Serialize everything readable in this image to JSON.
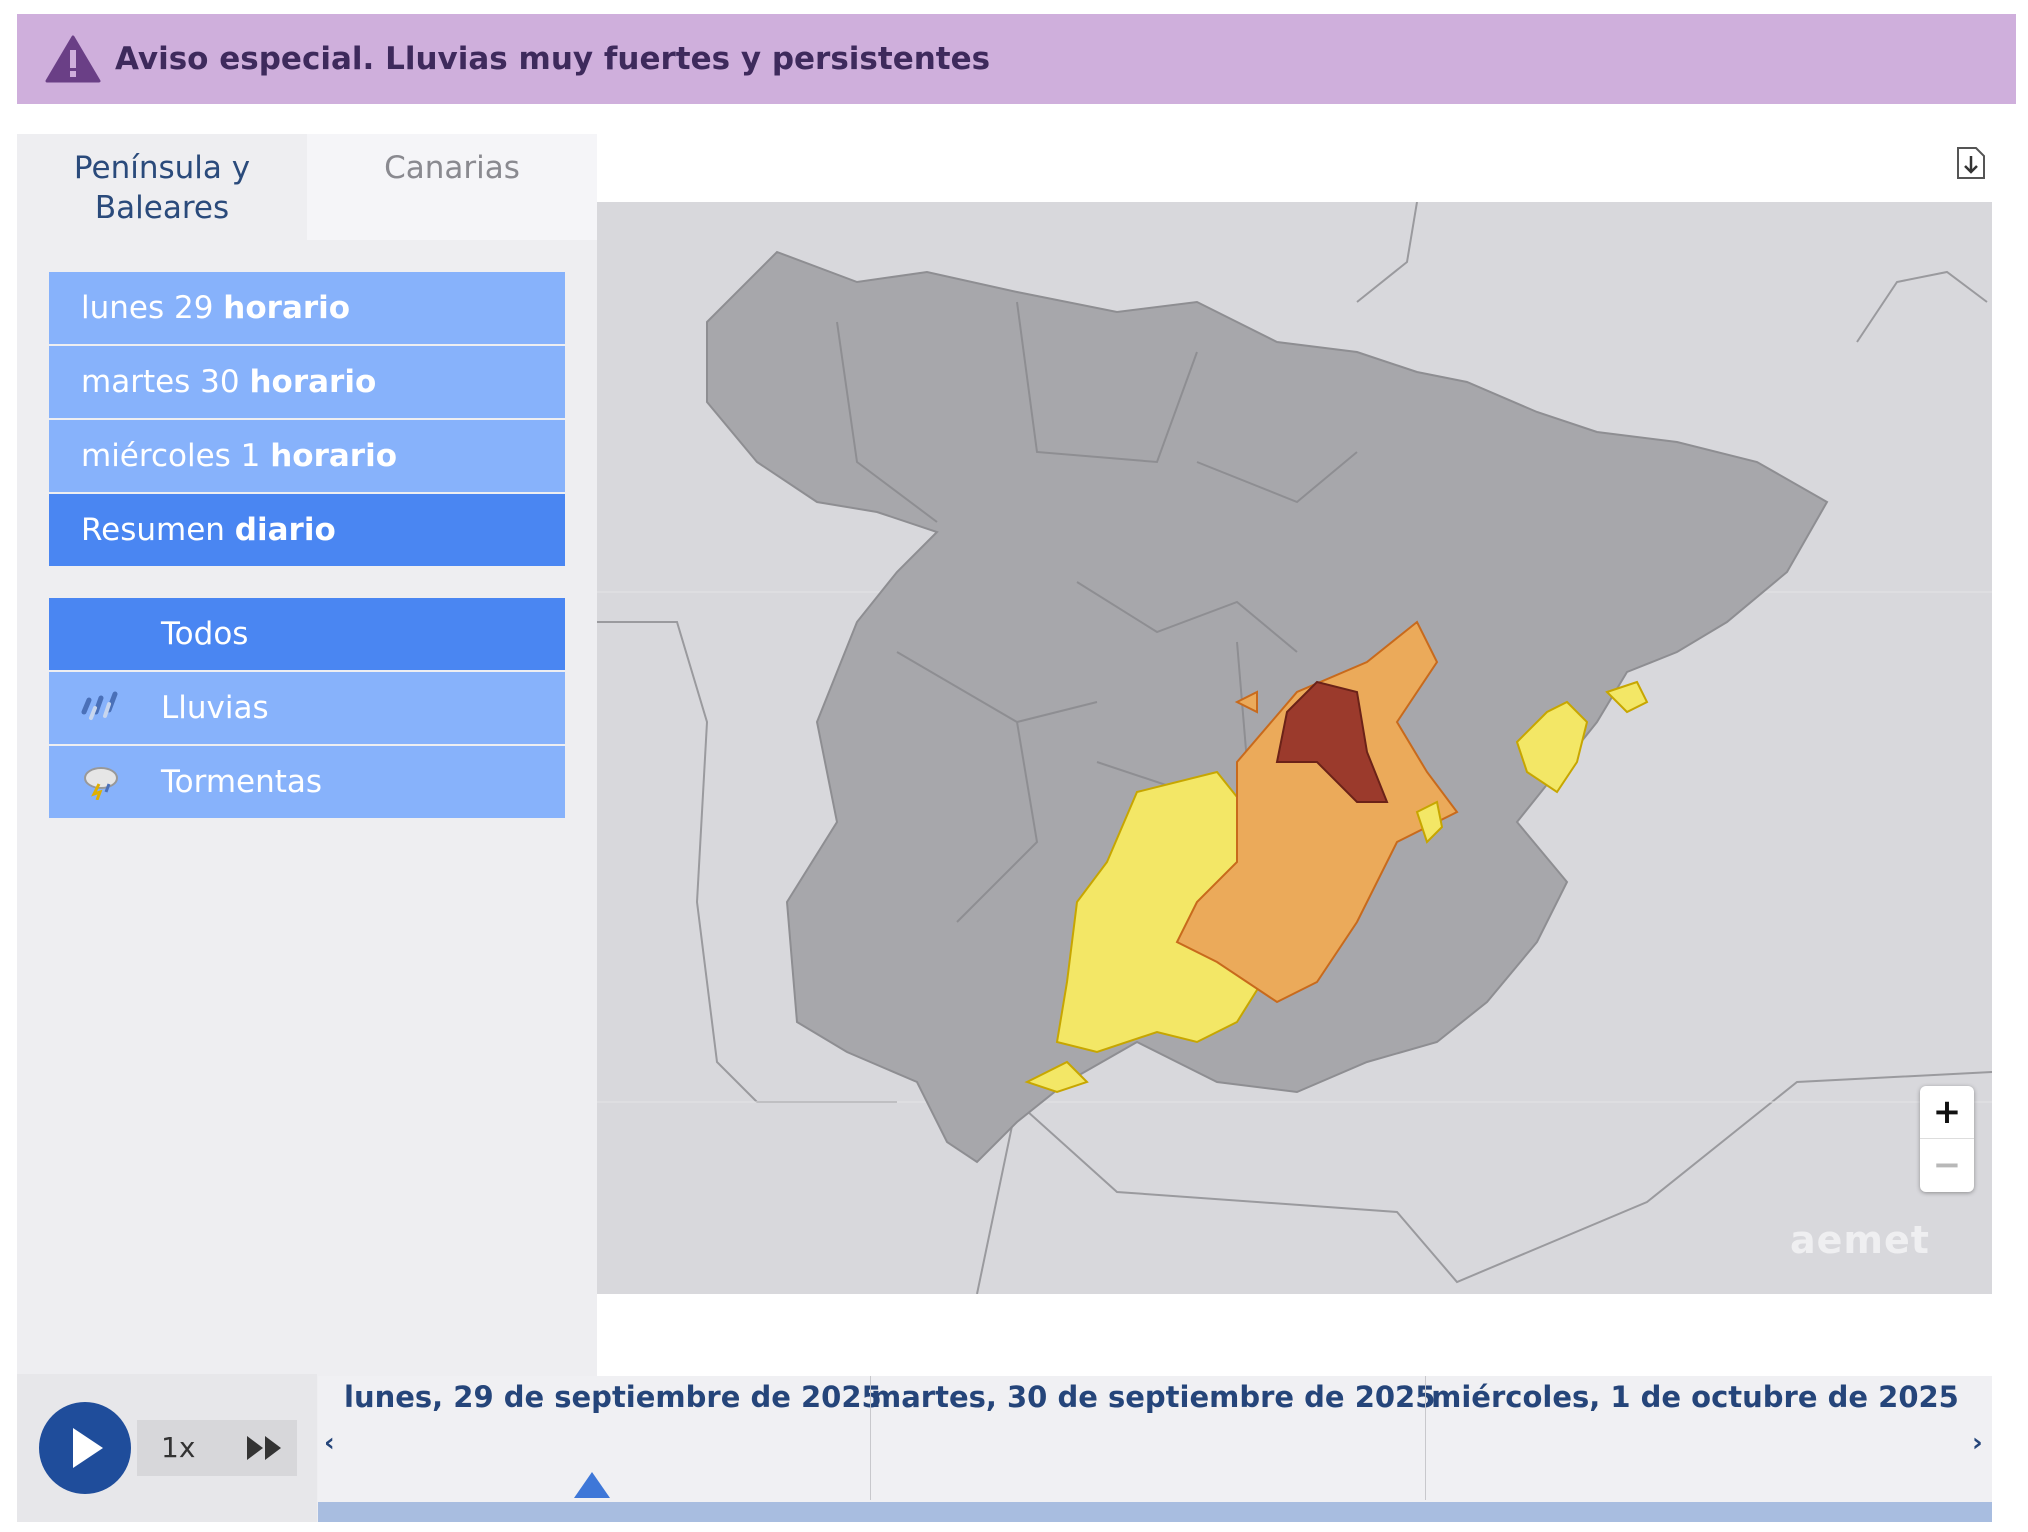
{
  "banner": {
    "title": "Aviso especial. Lluvias muy fuertes y persistentes",
    "color": "#cfafdc",
    "icon": "warning-icon"
  },
  "region_tabs": [
    {
      "label": "Península y Baleares",
      "active": true
    },
    {
      "label": "Canarias",
      "active": false
    }
  ],
  "day_buttons": [
    {
      "label": "lunes 29",
      "suffix": "horario",
      "active": false
    },
    {
      "label": "martes 30",
      "suffix": "horario",
      "active": false
    },
    {
      "label": "miércoles 1",
      "suffix": "horario",
      "active": false
    },
    {
      "label": "Resumen",
      "suffix": "diario",
      "active": true
    }
  ],
  "filters": [
    {
      "label": "Todos",
      "icon": null,
      "active": true
    },
    {
      "label": "Lluvias",
      "icon": "rain-icon",
      "active": false
    },
    {
      "label": "Tormentas",
      "icon": "storm-icon",
      "active": false
    }
  ],
  "map": {
    "watermark": "aemet",
    "zoom_in": "+",
    "zoom_out": "−",
    "warning_colors": {
      "yellow": "#f3e766",
      "orange": "#ebaa5a",
      "red": "#9b3a2c"
    }
  },
  "player": {
    "speed": "1x",
    "play_icon": "play-icon",
    "fast_forward_icon": "fast-forward-icon"
  },
  "timeline": {
    "days": [
      "lunes, 29 de septiembre de 2025",
      "martes, 30 de septiembre de 2025",
      "miércoles, 1 de octubre de 2025"
    ],
    "prev": "‹",
    "next": "›"
  }
}
